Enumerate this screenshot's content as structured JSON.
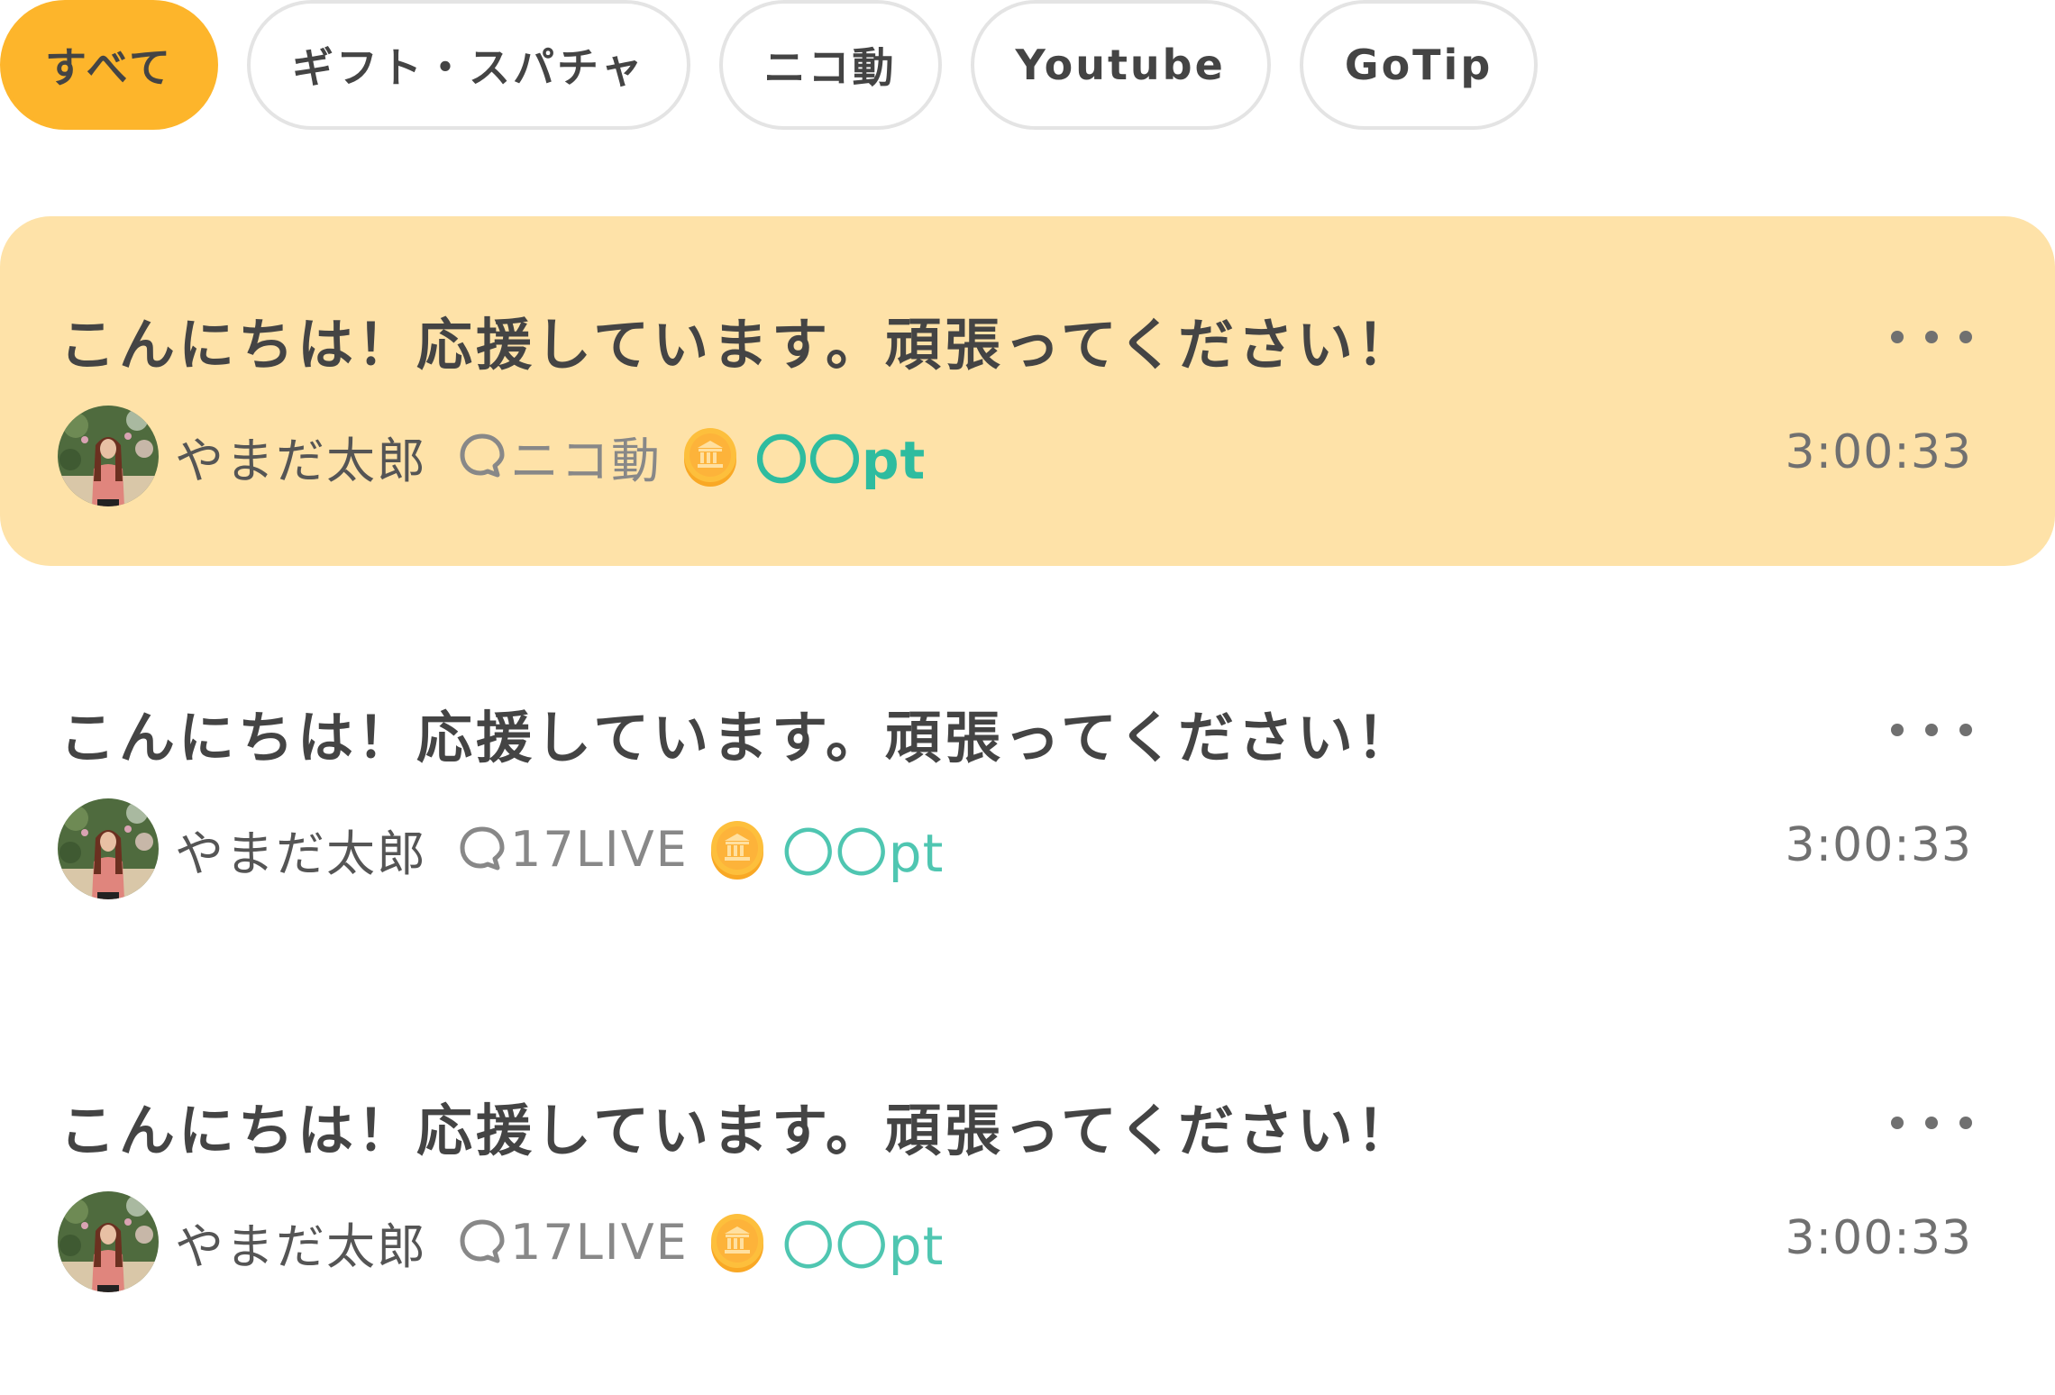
{
  "tabs": [
    {
      "label": "すべて",
      "active": true
    },
    {
      "label": "ギフト・スパチャ",
      "active": false
    },
    {
      "label": "ニコ動",
      "active": false
    },
    {
      "label": "Youtube",
      "active": false
    },
    {
      "label": "GoTip",
      "active": false
    }
  ],
  "colors": {
    "active_tab": "#fdb52b",
    "highlight_row": "#fee2a8",
    "points": "#2ebc9f",
    "text_primary": "#444444",
    "text_secondary": "#888888"
  },
  "messages": [
    {
      "title": "こんにちは！応援しています。頑張ってください！",
      "username": "やまだ太郎",
      "platform": "ニコ動",
      "points": "〇〇pt",
      "time": "3:00:33",
      "highlighted": true,
      "icons": {
        "avatar": "user-avatar-photo",
        "platform": "speech-bubble-icon",
        "coin": "coin-icon",
        "more": "more-horizontal-icon"
      }
    },
    {
      "title": "こんにちは！応援しています。頑張ってください！",
      "username": "やまだ太郎",
      "platform": "17LIVE",
      "points": "〇〇pt",
      "time": "3:00:33",
      "highlighted": false,
      "icons": {
        "avatar": "user-avatar-photo",
        "platform": "speech-bubble-icon",
        "coin": "coin-icon",
        "more": "more-horizontal-icon"
      }
    },
    {
      "title": "こんにちは！応援しています。頑張ってください！",
      "username": "やまだ太郎",
      "platform": "17LIVE",
      "points": "〇〇pt",
      "time": "3:00:33",
      "highlighted": false,
      "icons": {
        "avatar": "user-avatar-photo",
        "platform": "speech-bubble-icon",
        "coin": "coin-icon",
        "more": "more-horizontal-icon"
      }
    }
  ]
}
